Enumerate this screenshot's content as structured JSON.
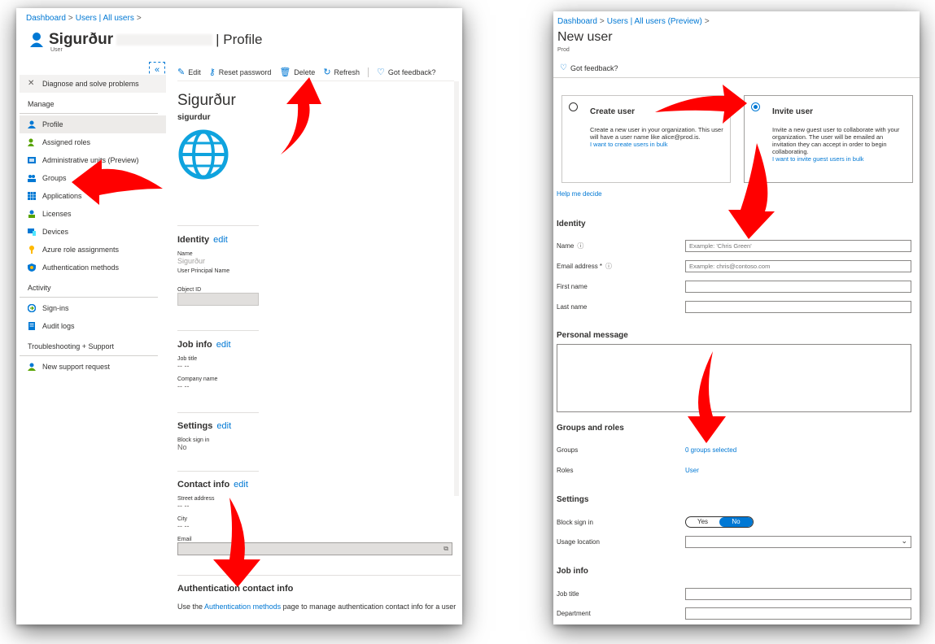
{
  "left": {
    "breadcrumb": [
      "Dashboard",
      "Users | All users"
    ],
    "user_name": "Sigurður",
    "user_title_suffix": "| Profile",
    "user_subtitle": "User",
    "collapse": "«",
    "nav": {
      "diagnose": "Diagnose and solve problems",
      "manage_header": "Manage",
      "items": [
        "Profile",
        "Assigned roles",
        "Administrative units (Preview)",
        "Groups",
        "Applications",
        "Licenses",
        "Devices",
        "Azure role assignments",
        "Authentication methods"
      ],
      "activity_header": "Activity",
      "activity_items": [
        "Sign-ins",
        "Audit logs"
      ],
      "support_header": "Troubleshooting + Support",
      "support_items": [
        "New support request"
      ]
    },
    "toolbar": [
      "Edit",
      "Reset password",
      "Delete",
      "Refresh",
      "Got feedback?"
    ],
    "content_name": "Sigurður",
    "content_username": "sigurdur",
    "identity": {
      "title": "Identity",
      "edit": "edit",
      "name_label": "Name",
      "name_value": "Sigurður",
      "upn_label": "User Principal Name",
      "object_label": "Object ID"
    },
    "job": {
      "title": "Job info",
      "edit": "edit",
      "job_title_label": "Job title",
      "job_title_value": "-- --",
      "company_label": "Company name",
      "company_value": "-- --"
    },
    "settings": {
      "title": "Settings",
      "edit": "edit",
      "block_label": "Block sign in",
      "block_value": "No"
    },
    "contact": {
      "title": "Contact info",
      "edit": "edit",
      "street_label": "Street address",
      "street_value": "-- --",
      "city_label": "City",
      "city_value": "-- --",
      "email_label": "Email"
    },
    "auth": {
      "title": "Authentication contact info",
      "text_prefix": "Use the ",
      "link": "Authentication methods",
      "text_suffix": " page to manage authentication contact info for a user"
    }
  },
  "right": {
    "breadcrumb": [
      "Dashboard",
      "Users | All users (Preview)"
    ],
    "title": "New user",
    "subtitle": "Prod",
    "feedback": "Got feedback?",
    "create": {
      "title": "Create user",
      "desc": "Create a new user in your organization. This user will have a user name like alice@prod.is.",
      "link": "I want to create users in bulk"
    },
    "invite": {
      "title": "Invite user",
      "desc": "Invite a new guest user to collaborate with your organization. The user will be emailed an invitation they can accept in order to begin collaborating.",
      "link": "I want to invite guest users in bulk"
    },
    "help": "Help me decide",
    "identity": {
      "title": "Identity",
      "name_label": "Name",
      "name_placeholder": "Example: 'Chris Green'",
      "email_label": "Email address *",
      "email_placeholder": "Example: chris@contoso.com",
      "first_label": "First name",
      "last_label": "Last name"
    },
    "personal_message": "Personal message",
    "groups": {
      "title": "Groups and roles",
      "groups_label": "Groups",
      "groups_value": "0 groups selected",
      "roles_label": "Roles",
      "roles_value": "User"
    },
    "settings": {
      "title": "Settings",
      "block_label": "Block sign in",
      "yes": "Yes",
      "no": "No",
      "usage_label": "Usage location"
    },
    "job": {
      "title": "Job info",
      "job_title_label": "Job title",
      "department_label": "Department"
    }
  },
  "colors": {
    "accent": "#0078d4",
    "arrow": "#ff0000"
  }
}
